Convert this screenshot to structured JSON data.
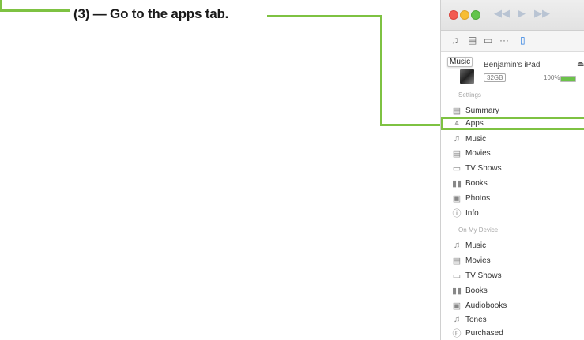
{
  "annotation": {
    "step": "(3)",
    "dash": " — ",
    "text": "Go to the apps tab.",
    "color": "#7ec242"
  },
  "window": {
    "titlebar": {
      "controls": [
        "rewind-icon",
        "play-icon",
        "fast-forward-icon"
      ]
    },
    "toolbar": {
      "icons": [
        "music-note-icon",
        "film-icon",
        "tv-icon",
        "more-icon",
        "ipad-icon"
      ]
    },
    "device": {
      "tooltip": "Music",
      "name": "Benjamin's iPad",
      "capacity": "32GB",
      "battery": "100%",
      "battery_level": 1.0
    },
    "settings": {
      "heading": "Settings",
      "items": [
        {
          "label": "Summary",
          "icon": "summary-icon"
        },
        {
          "label": "Apps",
          "icon": "apps-icon"
        },
        {
          "label": "Music",
          "icon": "music-note-icon"
        },
        {
          "label": "Movies",
          "icon": "film-icon"
        },
        {
          "label": "TV Shows",
          "icon": "tv-icon"
        },
        {
          "label": "Books",
          "icon": "books-icon"
        },
        {
          "label": "Photos",
          "icon": "camera-icon"
        },
        {
          "label": "Info",
          "icon": "info-icon"
        }
      ]
    },
    "on_device": {
      "heading": "On My Device",
      "items": [
        {
          "label": "Music",
          "icon": "music-note-icon"
        },
        {
          "label": "Movies",
          "icon": "film-icon"
        },
        {
          "label": "TV Shows",
          "icon": "tv-icon"
        },
        {
          "label": "Books",
          "icon": "books-icon"
        },
        {
          "label": "Audiobooks",
          "icon": "audiobooks-icon"
        },
        {
          "label": "Tones",
          "icon": "bell-icon"
        },
        {
          "label": "Purchased",
          "icon": "purchased-icon"
        }
      ]
    }
  }
}
